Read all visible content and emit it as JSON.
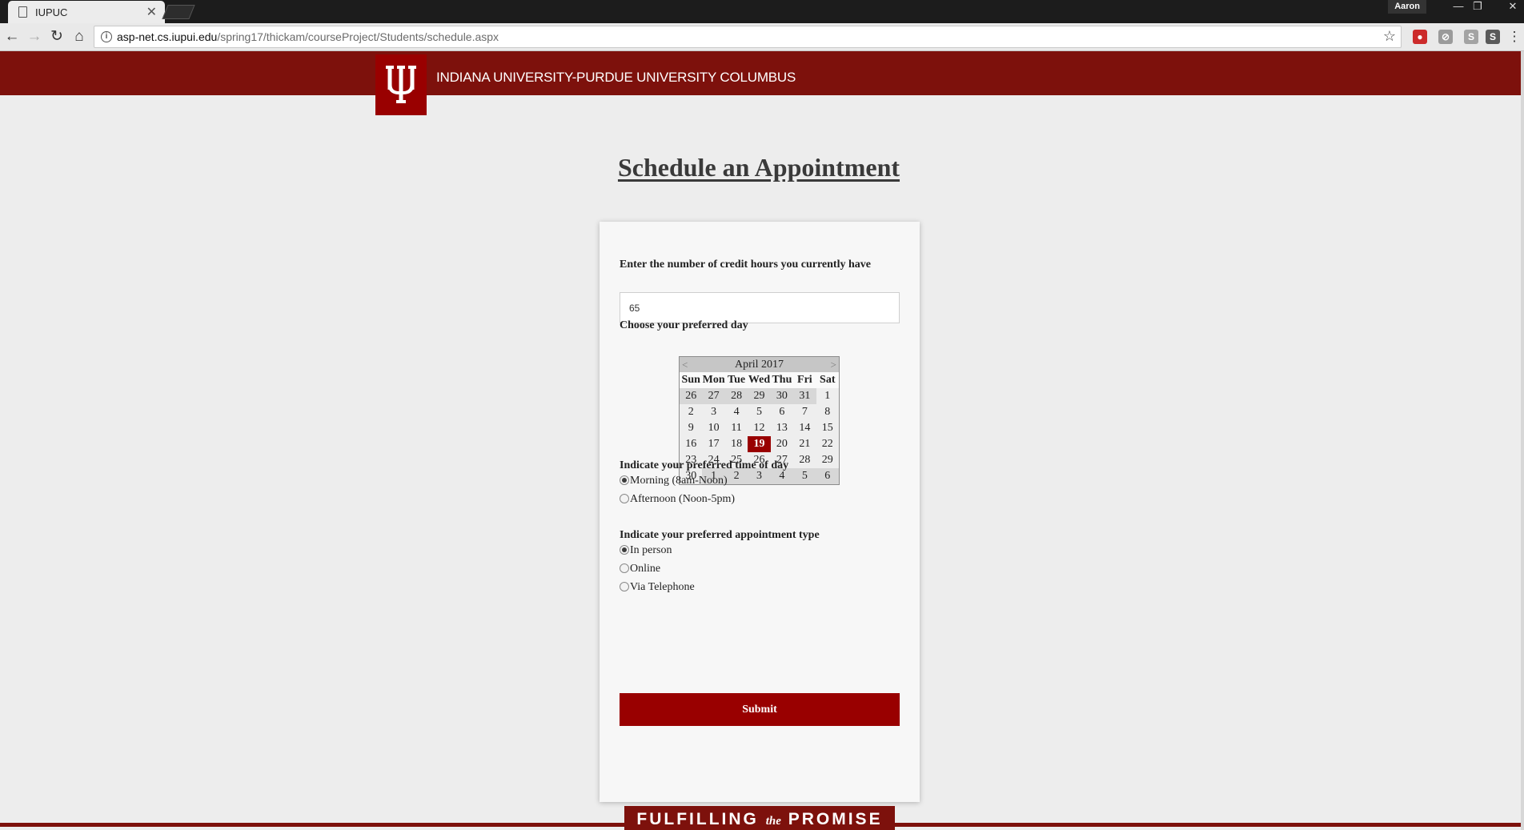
{
  "browser": {
    "tab_title": "IUPUC",
    "tab_close": "✕",
    "profile": "Aaron",
    "url_domain": "asp-net.cs.iupui.edu",
    "url_path": "/spring17/thickam/courseProject/Students/schedule.aspx",
    "info_icon_glyph": "i",
    "star_glyph": "☆",
    "back_glyph": "←",
    "forward_glyph": "→",
    "reload_glyph": "↻",
    "home_glyph": "⌂",
    "menu_glyph": "⋮",
    "win_min": "—",
    "win_max": "❐",
    "win_close": "✕",
    "extensions": [
      {
        "name": "record-extension-icon",
        "glyph": "●",
        "color": "#cc2b2b"
      },
      {
        "name": "block-extension-icon",
        "glyph": "⊘",
        "color": "#9a9a9a"
      },
      {
        "name": "s-extension-icon",
        "glyph": "S",
        "color": "#a3a3a3"
      },
      {
        "name": "s2-extension-icon",
        "glyph": "S",
        "color": "#5a5a5a"
      }
    ]
  },
  "site": {
    "header_title": "INDIANA UNIVERSITY-PURDUE UNIVERSITY COLUMBUS",
    "brand_color": "#990000",
    "header_color": "#7d110c",
    "footer_before": "FULFILLING ",
    "footer_the": "the",
    "footer_after": " PROMISE"
  },
  "page": {
    "title": "Schedule an Appointment"
  },
  "form": {
    "credit_label": "Enter the number of credit hours you currently have",
    "credit_value": "65",
    "day_label": "Choose your preferred day",
    "time_label": "Indicate your preferred time of day",
    "time_options": [
      {
        "label": "Morning (8am-Noon)",
        "checked": true
      },
      {
        "label": "Afternoon (Noon-5pm)",
        "checked": false
      }
    ],
    "type_label": "Indicate your preferred appointment type",
    "type_options": [
      {
        "label": "In person",
        "checked": true
      },
      {
        "label": "Online",
        "checked": false
      },
      {
        "label": "Via Telephone",
        "checked": false
      }
    ],
    "submit_label": "Submit"
  },
  "calendar": {
    "month_label": "April 2017",
    "prev": "<",
    "next": ">",
    "weekdays": [
      "Sun",
      "Mon",
      "Tue",
      "Wed",
      "Thu",
      "Fri",
      "Sat"
    ],
    "selected": 19,
    "weeks": [
      [
        {
          "d": "26",
          "o": true
        },
        {
          "d": "27",
          "o": true
        },
        {
          "d": "28",
          "o": true
        },
        {
          "d": "29",
          "o": true
        },
        {
          "d": "30",
          "o": true
        },
        {
          "d": "31",
          "o": true
        },
        {
          "d": "1",
          "o": false
        }
      ],
      [
        {
          "d": "2",
          "o": false
        },
        {
          "d": "3",
          "o": false
        },
        {
          "d": "4",
          "o": false
        },
        {
          "d": "5",
          "o": false
        },
        {
          "d": "6",
          "o": false
        },
        {
          "d": "7",
          "o": false
        },
        {
          "d": "8",
          "o": false
        }
      ],
      [
        {
          "d": "9",
          "o": false
        },
        {
          "d": "10",
          "o": false
        },
        {
          "d": "11",
          "o": false
        },
        {
          "d": "12",
          "o": false
        },
        {
          "d": "13",
          "o": false
        },
        {
          "d": "14",
          "o": false
        },
        {
          "d": "15",
          "o": false
        }
      ],
      [
        {
          "d": "16",
          "o": false
        },
        {
          "d": "17",
          "o": false
        },
        {
          "d": "18",
          "o": false
        },
        {
          "d": "19",
          "o": false
        },
        {
          "d": "20",
          "o": false
        },
        {
          "d": "21",
          "o": false
        },
        {
          "d": "22",
          "o": false
        }
      ],
      [
        {
          "d": "23",
          "o": false
        },
        {
          "d": "24",
          "o": false
        },
        {
          "d": "25",
          "o": false
        },
        {
          "d": "26",
          "o": false
        },
        {
          "d": "27",
          "o": false
        },
        {
          "d": "28",
          "o": false
        },
        {
          "d": "29",
          "o": false
        }
      ],
      [
        {
          "d": "30",
          "o": false
        },
        {
          "d": "1",
          "o": true
        },
        {
          "d": "2",
          "o": true
        },
        {
          "d": "3",
          "o": true
        },
        {
          "d": "4",
          "o": true
        },
        {
          "d": "5",
          "o": true
        },
        {
          "d": "6",
          "o": true
        }
      ]
    ]
  }
}
